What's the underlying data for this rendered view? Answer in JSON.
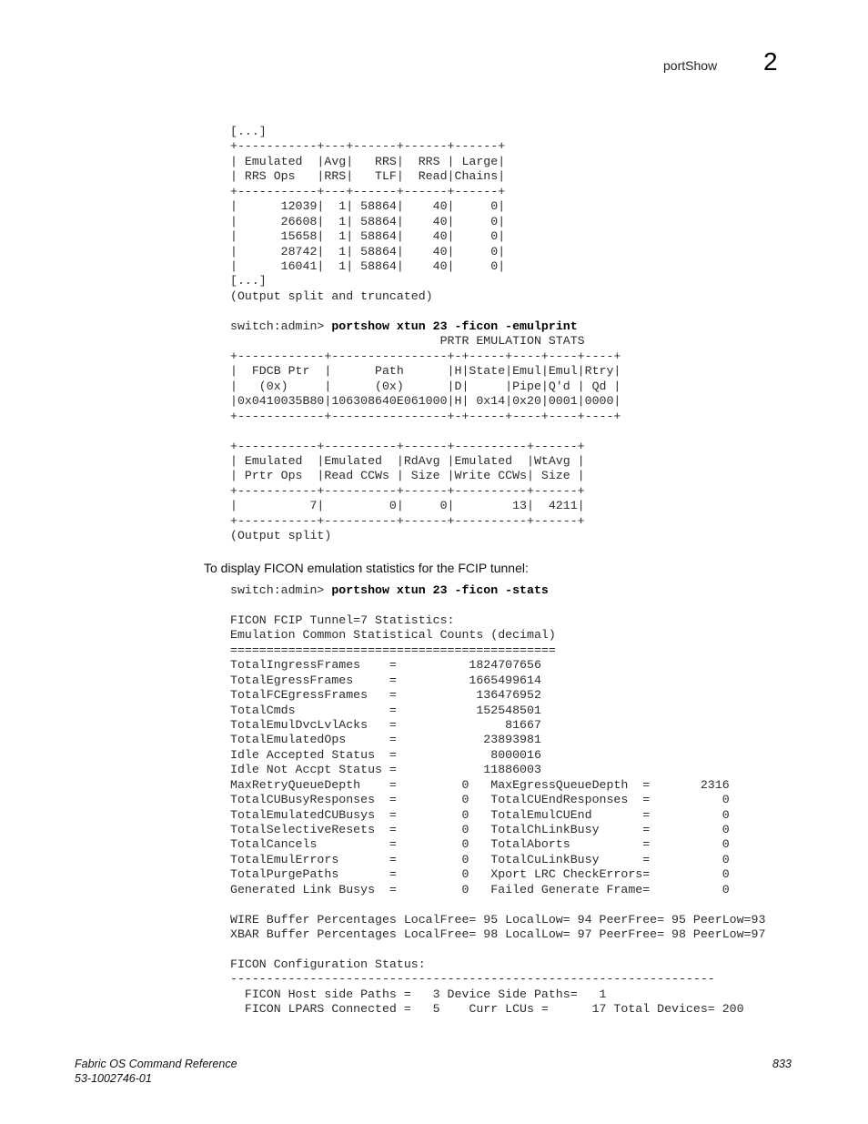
{
  "header": {
    "section_title": "portShow",
    "chapter_number": "2"
  },
  "block1": {
    "lines": [
      "[...]",
      "+-----------+---+------+------+------+",
      "| Emulated  |Avg|   RRS|  RRS | Large|",
      "| RRS Ops   |RRS|   TLF|  Read|Chains|",
      "+-----------+---+------+------+------+",
      "|      12039|  1| 58864|    40|     0|",
      "|      26608|  1| 58864|    40|     0|",
      "|      15658|  1| 58864|    40|     0|",
      "|      28742|  1| 58864|    40|     0|",
      "|      16041|  1| 58864|    40|     0|",
      "[...]",
      "(Output split and truncated)"
    ]
  },
  "block2": {
    "prompt": "switch:admin> ",
    "command": "portshow xtun 23 -ficon -emulprint",
    "lines": [
      "                             PRTR EMULATION STATS",
      "+------------+----------------+-+-----+----+----+----+",
      "|  FDCB Ptr  |      Path      |H|State|Emul|Emul|Rtry|",
      "|   (0x)     |      (0x)      |D|     |Pipe|Q'd | Qd |",
      "|0x0410035B80|106308640E061000|H| 0x14|0x20|0001|0000|",
      "+------------+----------------+-+-----+----+----+----+",
      "",
      "+-----------+----------+------+----------+------+",
      "| Emulated  |Emulated  |RdAvg |Emulated  |WtAvg |",
      "| Prtr Ops  |Read CCWs | Size |Write CCWs| Size |",
      "+-----------+----------+------+----------+------+",
      "|          7|         0|     0|        13|  4211|",
      "+-----------+----------+------+----------+------+",
      "(Output split)"
    ]
  },
  "prose": {
    "intro": "To display FICON emulation statistics for the FCIP tunnel:"
  },
  "block3": {
    "prompt": "switch:admin> ",
    "command": "portshow xtun 23 -ficon -stats",
    "lines": [
      "",
      "FICON FCIP Tunnel=7 Statistics:",
      "Emulation Common Statistical Counts (decimal)",
      "=============================================",
      "TotalIngressFrames    =          1824707656",
      "TotalEgressFrames     =          1665499614",
      "TotalFCEgressFrames   =           136476952",
      "TotalCmds             =           152548501",
      "TotalEmulDvcLvlAcks   =               81667",
      "TotalEmulatedOps      =            23893981",
      "Idle Accepted Status  =             8000016",
      "Idle Not Accpt Status =            11886003",
      "MaxRetryQueueDepth    =         0   MaxEgressQueueDepth  =       2316",
      "TotalCUBusyResponses  =         0   TotalCUEndResponses  =          0",
      "TotalEmulatedCUBusys  =         0   TotalEmulCUEnd       =          0",
      "TotalSelectiveResets  =         0   TotalChLinkBusy      =          0",
      "TotalCancels          =         0   TotalAborts          =          0",
      "TotalEmulErrors       =         0   TotalCuLinkBusy      =          0",
      "TotalPurgePaths       =         0   Xport LRC CheckErrors=          0",
      "Generated Link Busys  =         0   Failed Generate Frame=          0",
      "",
      "WIRE Buffer Percentages LocalFree= 95 LocalLow= 94 PeerFree= 95 PeerLow=93",
      "XBAR Buffer Percentages LocalFree= 98 LocalLow= 97 PeerFree= 98 PeerLow=97",
      "",
      "FICON Configuration Status:",
      "-------------------------------------------------------------------",
      "  FICON Host side Paths =   3 Device Side Paths=   1",
      "  FICON LPARS Connected =   5    Curr LCUs =      17 Total Devices= 200"
    ]
  },
  "footer": {
    "doc_title": "Fabric OS Command Reference",
    "doc_number": "53-1002746-01",
    "page_number": "833"
  }
}
